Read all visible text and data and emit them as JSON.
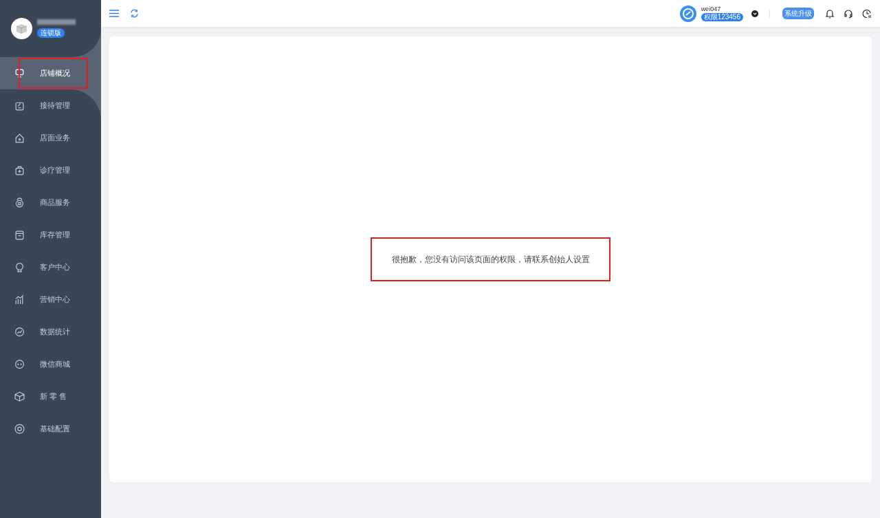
{
  "store": {
    "edition_badge": "连锁版"
  },
  "sidebar": {
    "items": [
      {
        "label": "店铺概况",
        "selected": true
      },
      {
        "label": "接待管理",
        "selected": false
      },
      {
        "label": "店面业务",
        "selected": false
      },
      {
        "label": "诊疗管理",
        "selected": false
      },
      {
        "label": "商品服务",
        "selected": false
      },
      {
        "label": "库存管理",
        "selected": false
      },
      {
        "label": "客户中心",
        "selected": false
      },
      {
        "label": "营销中心",
        "selected": false
      },
      {
        "label": "数据统计",
        "selected": false
      },
      {
        "label": "微信商城",
        "selected": false
      },
      {
        "label": "新 零 售",
        "selected": false
      },
      {
        "label": "基础配置",
        "selected": false
      }
    ]
  },
  "header": {
    "user": {
      "name": "wei047",
      "badge": "权限123456"
    },
    "upgrade_button": "系统升级"
  },
  "content": {
    "message": "很抱歉，您没有访问该页面的权限，请联系创始人设置"
  }
}
